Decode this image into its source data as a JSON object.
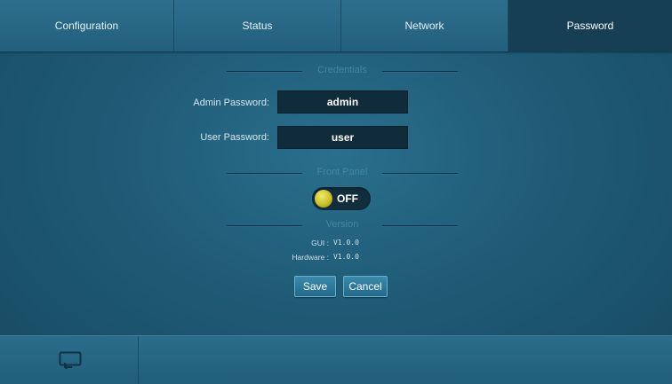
{
  "tabs": [
    {
      "label": "Configuration"
    },
    {
      "label": "Status"
    },
    {
      "label": "Network"
    },
    {
      "label": "Password"
    }
  ],
  "active_tab": "Password",
  "credentials": {
    "title": "Credentials",
    "admin_label": "Admin Password:",
    "admin_value": "admin",
    "user_label": "User Password:",
    "user_value": "user"
  },
  "front_panel": {
    "title": "Front Panel",
    "state": "OFF"
  },
  "version": {
    "title": "Version",
    "gui_label": "GUI :",
    "gui_value": "V1.0.0",
    "hardware_label": "Hardware :",
    "hardware_value": "V1.0.0"
  },
  "buttons": {
    "save": "Save",
    "cancel": "Cancel"
  },
  "icons": {
    "bottom_left": "back-return-icon"
  },
  "colors": {
    "accent_label": "#3f86a3",
    "toggle_knob": "#d6cc35"
  }
}
